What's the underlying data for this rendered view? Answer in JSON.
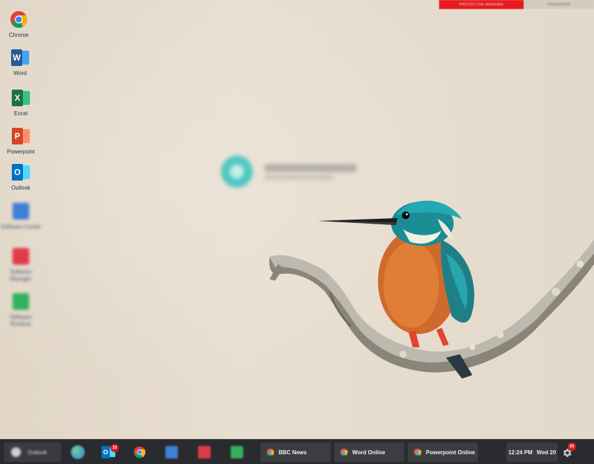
{
  "banner": {
    "classification": "PROTECTIVE MARKING",
    "secondary": "DISCOVERER"
  },
  "desktop_icons": [
    {
      "label": "Chrome",
      "icon": "chrome-icon"
    },
    {
      "label": "Word",
      "icon": "word-icon"
    },
    {
      "label": "Excel",
      "icon": "excel-icon"
    },
    {
      "label": "Powerpoint",
      "icon": "powerpoint-icon"
    },
    {
      "label": "Outlook",
      "icon": "outlook-icon"
    },
    {
      "label": "Software Center",
      "icon": "blurred-blue-app-icon"
    },
    {
      "label": "Software Manager",
      "icon": "blurred-red-app-icon"
    },
    {
      "label": "Software Runtime",
      "icon": "blurred-green-app-icon"
    }
  ],
  "login": {
    "name": "Welcome User Name",
    "sub": "status"
  },
  "taskbar": {
    "search_label": "Outlook",
    "outlook_badge": "10",
    "windows": [
      {
        "label": "BBC News",
        "icon": "chrome-icon"
      },
      {
        "label": "Word Online",
        "icon": "chrome-icon"
      },
      {
        "label": "Powerpoint Online",
        "icon": "chrome-icon"
      }
    ],
    "time": "12:24 PM",
    "date": "Wed 20",
    "settings_badge": "10"
  },
  "colors": {
    "banner_red": "#e8191d",
    "taskbar_bg": "#2a2b2f",
    "word_blue": "#2b5797",
    "excel_green": "#1e7145",
    "powerpoint_orange": "#d24726",
    "outlook_blue": "#0072c6"
  }
}
